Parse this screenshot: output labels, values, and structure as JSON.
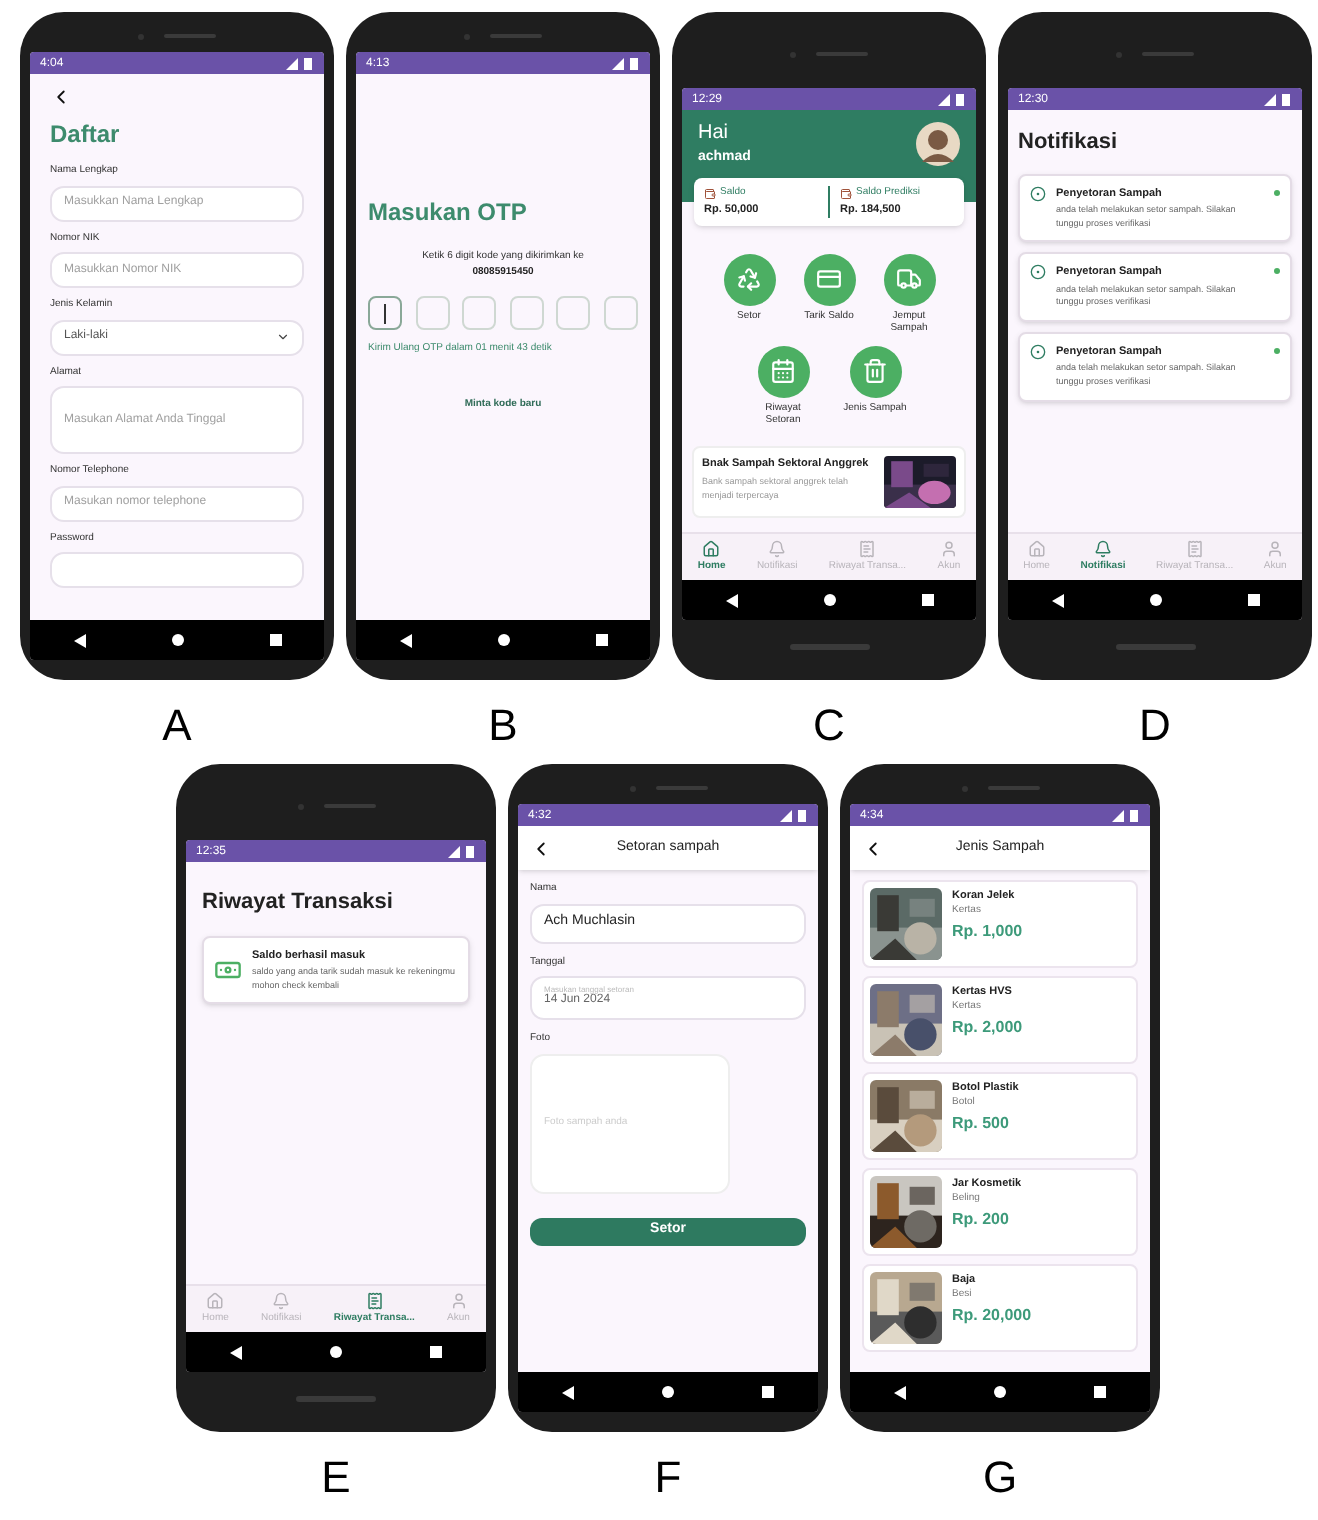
{
  "panels": [
    {
      "letter": "A",
      "tall_bezels": false,
      "kind": "register",
      "time": "4:04",
      "title": "Daftar",
      "fields": [
        {
          "label": "Nama Lengkap",
          "kind": "text",
          "placeholder": "Masukkan Nama Lengkap"
        },
        {
          "label": "Nomor NIK",
          "kind": "text",
          "placeholder": "Masukkan Nomor NIK"
        },
        {
          "label": "Jenis Kelamin",
          "kind": "select",
          "value": "Laki-laki"
        },
        {
          "label": "Alamat",
          "kind": "textarea",
          "placeholder": "Masukan Alamat Anda Tinggal"
        },
        {
          "label": "Nomor Telephone",
          "kind": "text",
          "placeholder": "Masukan nomor telephone"
        },
        {
          "label": "Password",
          "kind": "text"
        }
      ]
    },
    {
      "letter": "B",
      "tall_bezels": false,
      "kind": "otp",
      "time": "4:13",
      "title": "Masukan OTP",
      "instruction": "Ketik 6 digit kode yang dikirimkan ke",
      "phone": "08085915450",
      "boxes": [
        {
          "focused": true
        },
        {
          "focused": false
        },
        {
          "focused": false
        },
        {
          "focused": false
        },
        {
          "focused": false
        },
        {
          "focused": false
        }
      ],
      "timer": "Kirim Ulang OTP dalam 01 menit 43 detik",
      "resend": "Minta kode baru"
    },
    {
      "letter": "C",
      "tall_bezels": true,
      "kind": "home",
      "time": "12:29",
      "greeting": "Hai",
      "name": "achmad",
      "balances": [
        {
          "label": "Saldo",
          "value": "Rp. 50,000"
        },
        {
          "label": "Saldo Prediksi",
          "value": "Rp. 184,500"
        }
      ],
      "menu": [
        {
          "label": "Setor",
          "kind": "recycle"
        },
        {
          "label": "Tarik Saldo",
          "kind": "card"
        },
        {
          "label": "Jemput Sampah",
          "kind": "truck"
        },
        {
          "label": "Riwayat Setoran",
          "kind": "calendar"
        },
        {
          "label": "Jenis Sampah",
          "kind": "trash"
        }
      ],
      "news": {
        "title": "Bnak Sampah Sektoral Anggrek",
        "text": "Bank sampah sektoral anggrek telah menjadi terpercaya"
      },
      "nav": [
        {
          "label": "Home",
          "selected": true
        },
        {
          "label": "Notifikasi",
          "selected": false
        },
        {
          "label": "Riwayat Transa...",
          "selected": false
        },
        {
          "label": "Akun",
          "selected": false
        }
      ]
    },
    {
      "letter": "D",
      "tall_bezels": true,
      "kind": "notifications",
      "time": "12:30",
      "title": "Notifikasi",
      "items": [
        {
          "title": "Penyetoran Sampah",
          "text": "anda telah melakukan setor sampah. Silakan tunggu proses verifikasi",
          "unread": true
        },
        {
          "title": "Penyetoran Sampah",
          "text": "anda telah melakukan setor sampah. Silakan tunggu proses verifikasi",
          "unread": true
        },
        {
          "title": "Penyetoran Sampah",
          "text": "anda telah melakukan setor sampah. Silakan tunggu proses verifikasi",
          "unread": true
        }
      ],
      "nav": [
        {
          "label": "Home",
          "selected": false
        },
        {
          "label": "Notifikasi",
          "selected": true
        },
        {
          "label": "Riwayat Transa...",
          "selected": false
        },
        {
          "label": "Akun",
          "selected": false
        }
      ]
    },
    {
      "letter": "E",
      "tall_bezels": true,
      "kind": "history",
      "time": "12:35",
      "title": "Riwayat Transaksi",
      "items": [
        {
          "title": "Saldo berhasil masuk",
          "text": "saldo yang anda tarik sudah masuk ke rekeningmu mohon check kembali"
        }
      ],
      "nav": [
        {
          "label": "Home",
          "selected": false
        },
        {
          "label": "Notifikasi",
          "selected": false
        },
        {
          "label": "Riwayat Transa...",
          "selected": true
        },
        {
          "label": "Akun",
          "selected": false
        }
      ]
    },
    {
      "letter": "F",
      "tall_bezels": false,
      "kind": "deposit",
      "time": "4:32",
      "title": "Setoran sampah",
      "fields": [
        {
          "label": "Nama",
          "kind": "text",
          "value": "Ach Muchlasin"
        },
        {
          "label": "Tanggal",
          "kind": "date",
          "floating": "Masukan tanggal setoran",
          "value": "14 Jun 2024"
        },
        {
          "label": "Foto",
          "placeholder": "Foto sampah anda"
        }
      ],
      "button": "Setor"
    },
    {
      "letter": "G",
      "tall_bezels": false,
      "kind": "catalog",
      "time": "4:34",
      "title": "Jenis Sampah",
      "items": [
        {
          "name": "Koran Jelek",
          "category": "Kertas",
          "price": "Rp. 1,000"
        },
        {
          "name": "Kertas HVS",
          "category": "Kertas",
          "price": "Rp. 2,000"
        },
        {
          "name": "Botol Plastik",
          "category": "Botol",
          "price": "Rp. 500"
        },
        {
          "name": "Jar Kosmetik",
          "category": "Beling",
          "price": "Rp. 200"
        },
        {
          "name": "Baja",
          "category": "Besi",
          "price": "Rp. 20,000"
        }
      ]
    }
  ]
}
